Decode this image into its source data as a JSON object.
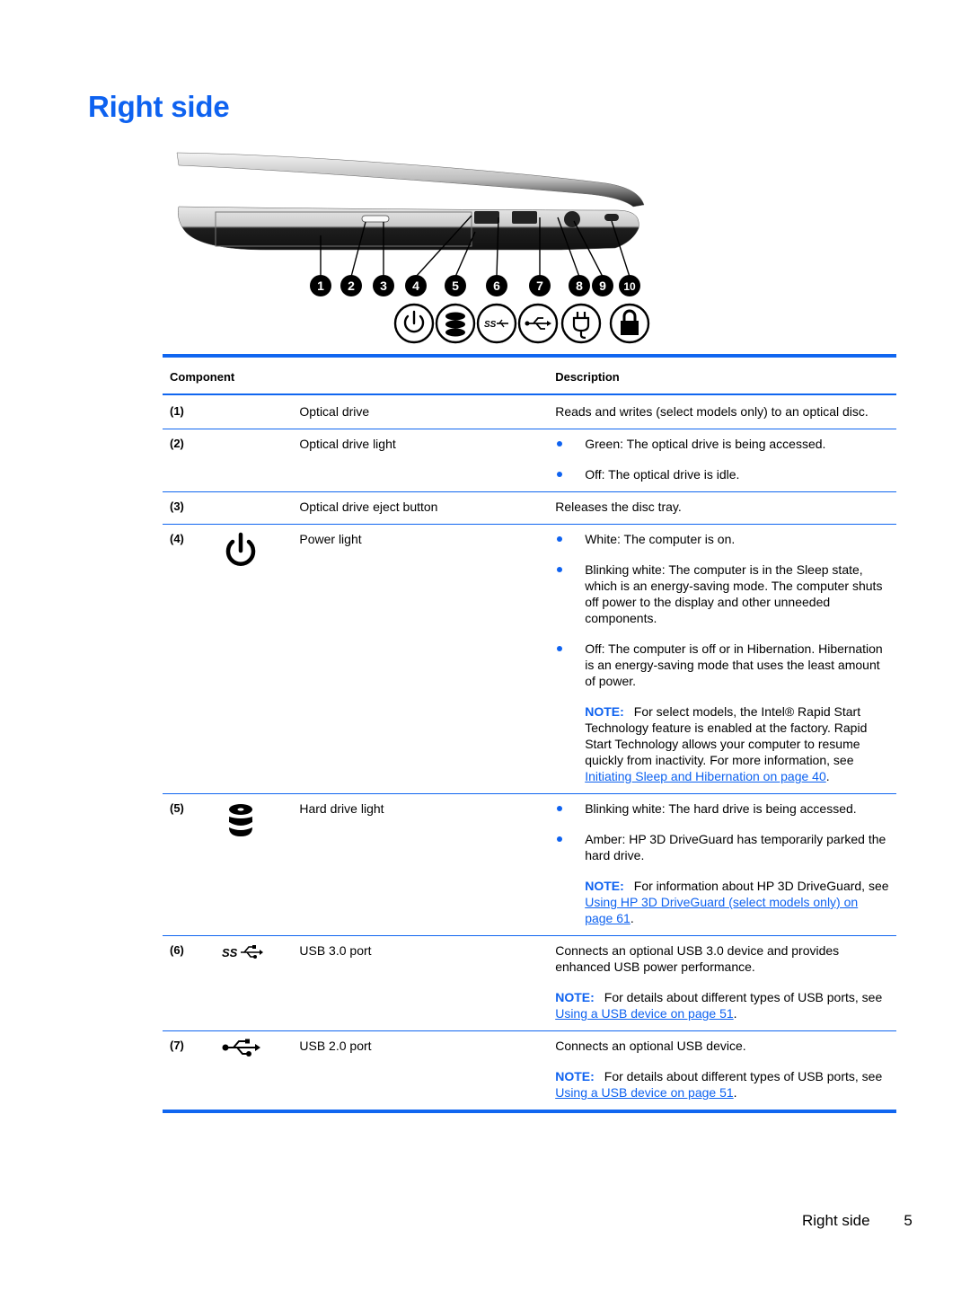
{
  "page_title": "Right side",
  "figure": {
    "callouts": [
      "1",
      "2",
      "3",
      "4",
      "5",
      "6",
      "7",
      "8",
      "9",
      "10"
    ],
    "legend_icons": [
      "power-icon",
      "hard-drive-icon",
      "usb-3-icon",
      "usb-icon",
      "power-plug-icon",
      "lock-icon"
    ]
  },
  "table": {
    "headers": {
      "component": "Component",
      "description": "Description"
    },
    "rows": [
      {
        "num": "(1)",
        "icon": "",
        "name": "Optical drive",
        "desc": "Reads and writes (select models only) to an optical disc."
      },
      {
        "num": "(2)",
        "icon": "",
        "name": "Optical drive light",
        "bullets": [
          "Green: The optical drive is being accessed.",
          "Off: The optical drive is idle."
        ]
      },
      {
        "num": "(3)",
        "icon": "",
        "name": "Optical drive eject button",
        "desc": "Releases the disc tray."
      },
      {
        "num": "(4)",
        "icon": "power-icon",
        "name": "Power light",
        "bullets": [
          "White: The computer is on.",
          "Blinking white: The computer is in the Sleep state, which is an energy-saving mode. The computer shuts off power to the display and other unneeded components.",
          "Off: The computer is off or in Hibernation. Hibernation is an energy-saving mode that uses the least amount of power."
        ],
        "note": {
          "label": "NOTE:",
          "text": "For select models, the Intel® Rapid Start Technology feature is enabled at the factory. Rapid Start Technology allows your computer to resume quickly from inactivity. For more information, see ",
          "link": "Initiating Sleep and Hibernation on page 40",
          "after": "."
        }
      },
      {
        "num": "(5)",
        "icon": "hard-drive-icon",
        "name": "Hard drive light",
        "bullets": [
          "Blinking white: The hard drive is being accessed.",
          "Amber: HP 3D DriveGuard has temporarily parked the hard drive."
        ],
        "note": {
          "label": "NOTE:",
          "text": "For information about HP 3D DriveGuard, see ",
          "link": "Using HP 3D DriveGuard (select models only) on page 61",
          "after": "."
        }
      },
      {
        "num": "(6)",
        "icon": "usb-3-icon",
        "name": "USB 3.0 port",
        "desc": "Connects an optional USB 3.0 device and provides enhanced USB power performance.",
        "note": {
          "label": "NOTE:",
          "text": "For details about different types of USB ports, see ",
          "link": "Using a USB device on page 51",
          "after": "."
        }
      },
      {
        "num": "(7)",
        "icon": "usb-icon",
        "name": "USB 2.0 port",
        "desc": "Connects an optional USB device.",
        "note": {
          "label": "NOTE:",
          "text": "For details about different types of USB ports, see ",
          "link": "Using a USB device on page 51",
          "after": "."
        }
      }
    ]
  },
  "footer": {
    "section": "Right side",
    "page": "5"
  },
  "colors": {
    "accent": "#0e62f0",
    "rule": "#1066f0",
    "text": "#000000"
  }
}
